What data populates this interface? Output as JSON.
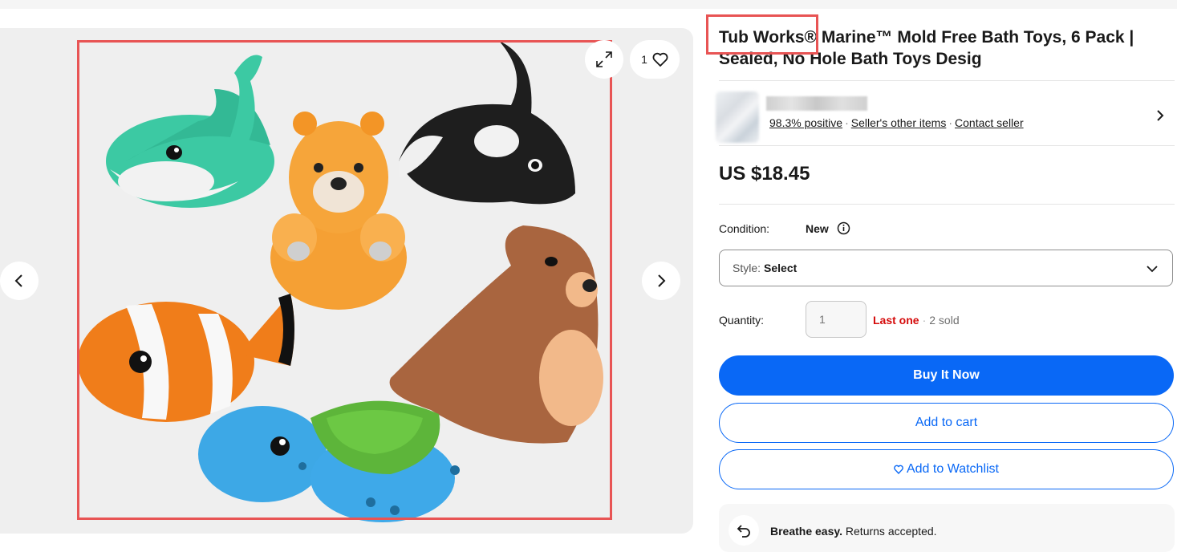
{
  "gallery": {
    "watch_count": "1",
    "prev_icon": "chevron-left-icon",
    "next_icon": "chevron-right-icon",
    "expand_icon": "expand-icon",
    "heart_icon": "heart-icon"
  },
  "listing": {
    "title": "Tub Works® Marine™ Mold Free Bath Toys, 6 Pack | Sealed, No Hole Bath Toys Desig",
    "price": "US $18.45"
  },
  "seller": {
    "feedback": "98.3% positive",
    "other_items": "Seller's other items",
    "contact": "Contact seller"
  },
  "condition": {
    "label": "Condition:",
    "value": "New"
  },
  "style_select": {
    "label": "Style:",
    "value": "Select"
  },
  "quantity": {
    "label": "Quantity:",
    "placeholder": "1",
    "availability": "Last one",
    "sold": "2 sold"
  },
  "actions": {
    "buy_now": "Buy It Now",
    "add_to_cart": "Add to cart",
    "add_to_watchlist": "Add to Watchlist"
  },
  "returns": {
    "bold": "Breathe easy.",
    "text": "Returns accepted."
  },
  "colors": {
    "primary_blue": "#0968f6",
    "alert_red": "#d50b0b",
    "highlight_box": "#e85454"
  }
}
